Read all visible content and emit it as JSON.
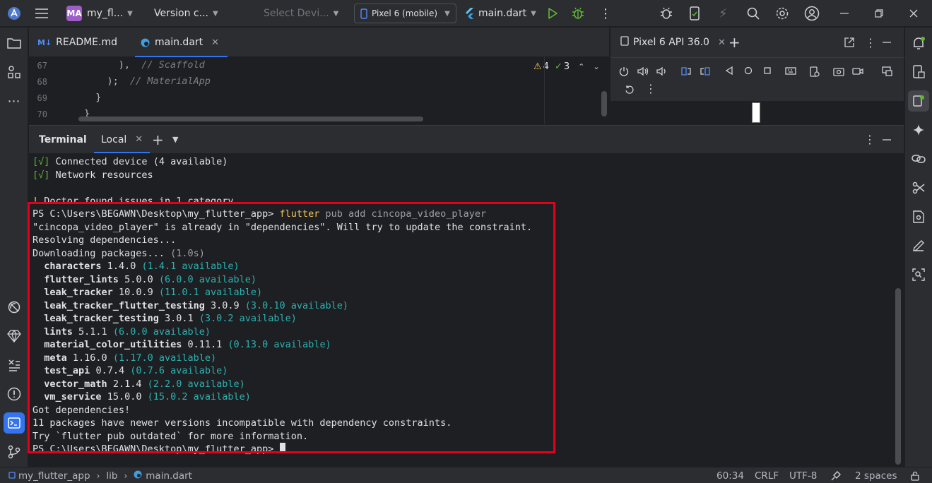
{
  "titlebar": {
    "project_badge": "MA",
    "project_name": "my_fl...",
    "vcs": "Version c...",
    "device_select_placeholder": "Select Devi...",
    "device": "Pixel 6 (mobile)",
    "run_config": "main.dart"
  },
  "editor": {
    "tabs": [
      {
        "label": "README.md",
        "badge": "M↓"
      },
      {
        "label": "main.dart"
      }
    ],
    "lines": [
      {
        "num": "67",
        "code": "      ),",
        "comment": "// Scaffold"
      },
      {
        "num": "68",
        "code": "    );",
        "comment": "// MaterialApp"
      },
      {
        "num": "69",
        "code": "  }",
        "comment": ""
      },
      {
        "num": "70",
        "code": "}",
        "comment": ""
      }
    ],
    "warnings": "4",
    "checks": "3"
  },
  "device_panel": {
    "tab_label": "Pixel 6 API 36.0"
  },
  "terminal": {
    "title": "Terminal",
    "tab_label": "Local",
    "pre_lines": [
      {
        "mark": "[√]",
        "text": " Connected device (4 available)"
      },
      {
        "mark": "[√]",
        "text": " Network resources"
      },
      {
        "mark": "",
        "text": ""
      },
      {
        "mark": "!",
        "text": " Doctor found issues in 1 category."
      }
    ],
    "prompt": "PS C:\\Users\\BEGAWN\\Desktop\\my_flutter_app> ",
    "command": "flutter",
    "command_args": " pub add cincopa_video_player",
    "out_lines": [
      "\"cincopa_video_player\" is already in \"dependencies\". Will try to update the constraint.",
      "Resolving dependencies..."
    ],
    "downloading": "Downloading packages...",
    "downloading_time": " (1.0s)",
    "packages": [
      {
        "name": "characters",
        "version": "1.4.0",
        "available": "(1.4.1 available)"
      },
      {
        "name": "flutter_lints",
        "version": "5.0.0",
        "available": "(6.0.0 available)"
      },
      {
        "name": "leak_tracker",
        "version": "10.0.9",
        "available": "(11.0.1 available)"
      },
      {
        "name": "leak_tracker_flutter_testing",
        "version": "3.0.9",
        "available": "(3.0.10 available)"
      },
      {
        "name": "leak_tracker_testing",
        "version": "3.0.1",
        "available": "(3.0.2 available)"
      },
      {
        "name": "lints",
        "version": "5.1.1",
        "available": "(6.0.0 available)"
      },
      {
        "name": "material_color_utilities",
        "version": "0.11.1",
        "available": "(0.13.0 available)"
      },
      {
        "name": "meta",
        "version": "1.16.0",
        "available": "(1.17.0 available)"
      },
      {
        "name": "test_api",
        "version": "0.7.4",
        "available": "(0.7.6 available)"
      },
      {
        "name": "vector_math",
        "version": "2.1.4",
        "available": "(2.2.0 available)"
      },
      {
        "name": "vm_service",
        "version": "15.0.0",
        "available": "(15.0.2 available)"
      }
    ],
    "final_lines": [
      "Got dependencies!",
      "11 packages have newer versions incompatible with dependency constraints.",
      "Try `flutter pub outdated` for more information."
    ],
    "final_prompt": "PS C:\\Users\\BEGAWN\\Desktop\\my_flutter_app> "
  },
  "statusbar": {
    "breadcrumb": [
      "my_flutter_app",
      "lib",
      "main.dart"
    ],
    "position": "60:34",
    "line_ending": "CRLF",
    "encoding": "UTF-8",
    "indent": "2 spaces"
  },
  "colors": {
    "accent": "#3574f0",
    "highlight_box": "#e3001b",
    "prompt_command": "#f2c55c",
    "available_text": "#2bb1b1",
    "run_icon": "#5fb832"
  }
}
